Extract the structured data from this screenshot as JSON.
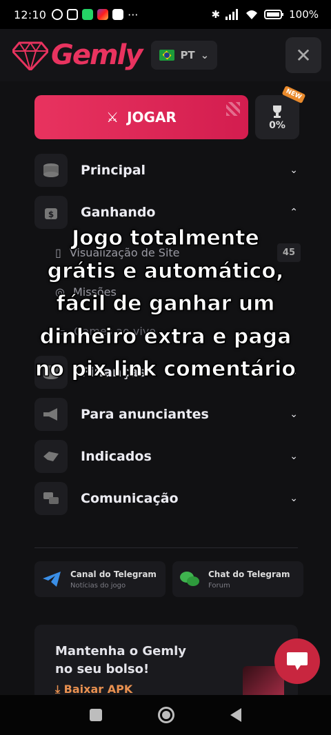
{
  "status_bar": {
    "time": "12:10",
    "battery": "100%",
    "icons": [
      "alarm-icon",
      "nfc-icon",
      "whatsapp-icon",
      "instagram-icon",
      "google-icon",
      "more-dots-icon",
      "bluetooth-icon",
      "signal-icon",
      "wifi-icon",
      "battery-icon"
    ]
  },
  "header": {
    "logo_text": "Gemly",
    "language": "PT"
  },
  "play": {
    "label": "JOGAR",
    "trophy_value": "0%",
    "new_badge": "NEW"
  },
  "menu": [
    {
      "label": "Principal",
      "icon": "coins-stack-icon",
      "expanded": false
    },
    {
      "label": "Ganhando",
      "icon": "money-bag-icon",
      "expanded": true,
      "sub": [
        {
          "label": "Visualização de Site",
          "count": "45"
        },
        {
          "label": "Missões"
        },
        {
          "label": "Games ao vivo"
        }
      ]
    },
    {
      "label": "Finanças",
      "icon": "coins-stack-icon",
      "expanded": false
    },
    {
      "label": "Para anunciantes",
      "icon": "megaphone-icon",
      "expanded": false
    },
    {
      "label": "Indicados",
      "icon": "handshake-icon",
      "expanded": false
    },
    {
      "label": "Comunicação",
      "icon": "chat-bubbles-icon",
      "expanded": false
    }
  ],
  "telegram": [
    {
      "title": "Canal do Telegram",
      "subtitle": "Notícias do jogo",
      "icon": "telegram-icon"
    },
    {
      "title": "Chat do Telegram",
      "subtitle": "Forum",
      "icon": "wechat-icon"
    }
  ],
  "app_promo": {
    "title_line1": "Mantenha o Gemly",
    "title_line2": "no seu bolso!",
    "download": "Baixar APK"
  },
  "overlay_caption": [
    "Jogo totalmente",
    "grátis e automático,",
    "fácil de ganhar um",
    "dinheiro extra e paga",
    "no pix link comentário"
  ],
  "colors": {
    "brand": "#e8335f",
    "background": "#111113",
    "accent_orange": "#e89050"
  }
}
